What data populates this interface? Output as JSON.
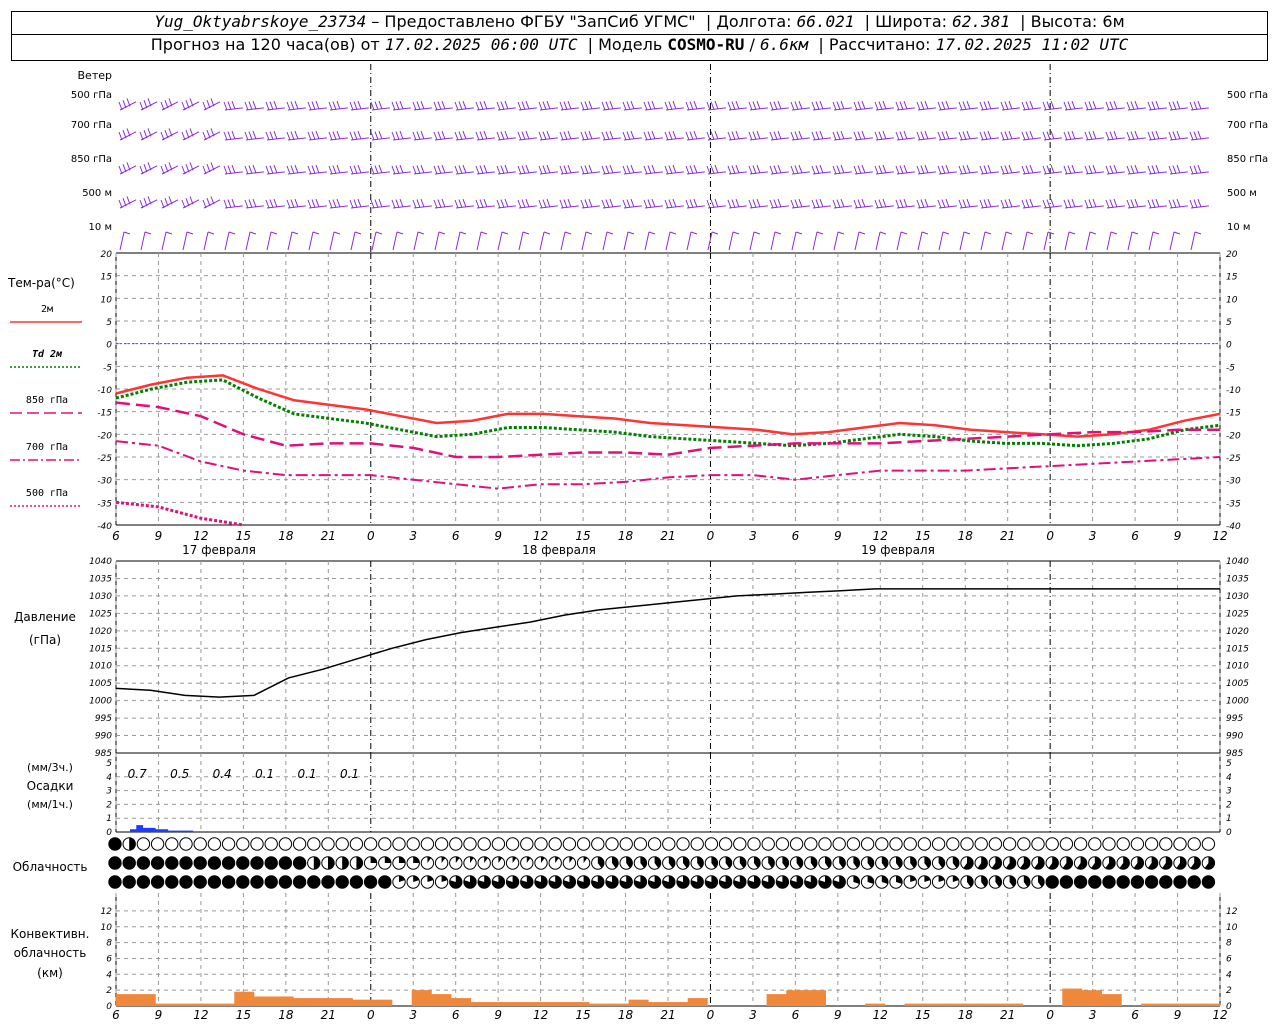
{
  "header": {
    "station": "Yug_Oktyabrskoye_23734",
    "dash": " – ",
    "provider": "Предоставлено ФГБУ \"ЗапСиб УГМС\"",
    "lon_label": "Долгота:",
    "lon": "66.021",
    "lat_label": "Широта:",
    "lat": "62.381",
    "alt_label": "Высота:",
    "alt": "6м",
    "forecast_prefix": "Прогноз на 120 часа(ов) от",
    "forecast_time": "17.02.2025 06:00 UTC",
    "model_label": "Модель",
    "model": "COSMO-RU",
    "model_res": "6.6км",
    "calc_label": "Рассчитано:",
    "calc_time": "17.02.2025 11:02 UTC"
  },
  "wind": {
    "title": "Ветер",
    "levels": [
      "500 гПа",
      "700 гПа",
      "850 гПа",
      "500 м",
      "10 м"
    ]
  },
  "temperature": {
    "title": "Тем-ра(°С)",
    "legend": [
      {
        "label": "2м",
        "color": "#ff3333",
        "style": "solid"
      },
      {
        "label": "Td 2м",
        "color": "#008000",
        "style": "dotted"
      },
      {
        "label": "850 гПа",
        "color": "#e0107a",
        "style": "longdash"
      },
      {
        "label": "700 гПа",
        "color": "#e0107a",
        "style": "dashdot"
      },
      {
        "label": "500 гПа",
        "color": "#e0107a",
        "style": "dotted"
      }
    ]
  },
  "time_axis": {
    "hour_ticks": [
      "6",
      "9",
      "12",
      "15",
      "18",
      "21",
      "0",
      "3",
      "6",
      "9",
      "12",
      "15",
      "18",
      "21",
      "0",
      "3",
      "6",
      "9",
      "12",
      "15",
      "18",
      "21",
      "0",
      "3",
      "6",
      "9",
      "12"
    ],
    "dates": [
      "17 февраля",
      "18 февраля",
      "19 февраля"
    ]
  },
  "pressure": {
    "title": "Давление",
    "unit": "(гПа)"
  },
  "precip": {
    "unit3": "(мм/3ч.)",
    "title": "Осадки",
    "unit1": "(мм/1ч.)",
    "labels": [
      "0.7",
      "0.5",
      "0.4",
      "0.1",
      "0.1",
      "0.1"
    ]
  },
  "clouds": {
    "title": "Облачность"
  },
  "convective": {
    "title1": "Конвективн.",
    "title2": "облачность",
    "unit": "(км)"
  },
  "colors": {
    "wind": "#8a2be2",
    "pressure": "#000000",
    "precip": "#1e3cff",
    "convective": "#f0883c",
    "zero_line": "#3050ff"
  },
  "chart_data": [
    {
      "type": "line",
      "title": "Тем-ра(°С)",
      "x_hours_from_start": [
        0,
        3,
        6,
        9,
        12,
        15,
        18,
        21,
        24,
        27,
        30,
        33,
        36,
        39,
        42,
        45,
        48,
        51,
        54,
        57,
        60,
        63,
        66,
        69,
        72,
        75,
        78
      ],
      "x_tick_labels": [
        "6",
        "9",
        "12",
        "15",
        "18",
        "21",
        "0",
        "3",
        "6",
        "9",
        "12",
        "15",
        "18",
        "21",
        "0",
        "3",
        "6",
        "9",
        "12",
        "15",
        "18",
        "21",
        "0",
        "3",
        "6",
        "9",
        "12"
      ],
      "ylim": [
        -40,
        20
      ],
      "y_ticks": [
        -40,
        -35,
        -30,
        -25,
        -20,
        -15,
        -10,
        -5,
        0,
        5,
        10,
        15,
        20
      ],
      "series": [
        {
          "name": "2м",
          "values": [
            -11,
            -9,
            -7.5,
            -7,
            -10,
            -12.5,
            -13.5,
            -14.5,
            -16,
            -17.5,
            -17,
            -15.5,
            -15.5,
            -16,
            -16.5,
            -17.5,
            -18,
            -18.5,
            -19,
            -20,
            -19.5,
            -18.5,
            -17.5,
            -18,
            -19,
            -19.5,
            -20,
            -20.5,
            -20,
            -19,
            -17,
            -15.5
          ]
        },
        {
          "name": "Td 2м",
          "values": [
            -12,
            -10,
            -8.5,
            -8,
            -12,
            -15.5,
            -16.5,
            -17.5,
            -19,
            -20.5,
            -20,
            -18.5,
            -18.5,
            -19,
            -19.5,
            -20.5,
            -21,
            -21.5,
            -22,
            -22.5,
            -22,
            -21,
            -20,
            -20.5,
            -21.5,
            -22,
            -22,
            -22.5,
            -22,
            -21,
            -19,
            -18
          ]
        },
        {
          "name": "850 гПа",
          "values": [
            -13,
            -14,
            -16,
            -20,
            -22.5,
            -22,
            -22,
            -23,
            -25,
            -25,
            -24.5,
            -24,
            -24,
            -24.5,
            -23,
            -22.5,
            -22,
            -22,
            -22,
            -21.5,
            -21,
            -20.5,
            -20,
            -19.5,
            -19.5,
            -19,
            -19
          ]
        },
        {
          "name": "700 гПа",
          "values": [
            -21.5,
            -22.5,
            -26,
            -28,
            -29,
            -29,
            -29,
            -30,
            -31,
            -32,
            -31,
            -31,
            -30.5,
            -29.5,
            -29,
            -29,
            -30,
            -29,
            -28,
            -28,
            -28,
            -27.5,
            -27,
            -26.5,
            -26,
            -25.5,
            -25
          ]
        },
        {
          "name": "500 гПа",
          "values": [
            -35,
            -36,
            -38.5,
            -40
          ]
        }
      ]
    },
    {
      "type": "line",
      "title": "Давление",
      "ylim": [
        985,
        1040
      ],
      "y_ticks": [
        985,
        990,
        995,
        1000,
        1005,
        1010,
        1015,
        1020,
        1025,
        1030,
        1035,
        1040
      ],
      "series": [
        {
          "name": "Давление",
          "values": [
            1003.5,
            1003,
            1001.5,
            1001,
            1001.5,
            1006.5,
            1009,
            1012,
            1015,
            1017.5,
            1019.5,
            1021,
            1022.5,
            1024.5,
            1026,
            1027,
            1028,
            1029,
            1030,
            1030.5,
            1031,
            1031.5,
            1032,
            1032,
            1032,
            1032,
            1032,
            1032,
            1032,
            1032,
            1032,
            1032,
            1032
          ]
        }
      ]
    },
    {
      "type": "bar",
      "title": "Осадки",
      "ylim": [
        0,
        5
      ],
      "values_mm_per_1h": [
        0.2,
        0.5,
        0.3,
        0.3,
        0.2,
        0.2,
        0.1,
        0.1,
        0.1,
        0.1,
        0.05,
        0.05,
        0,
        0,
        0,
        0,
        0,
        0,
        0,
        0,
        0,
        0.05,
        0,
        0,
        0,
        0,
        0,
        0.05,
        0,
        0,
        0,
        0,
        0,
        0,
        0,
        0,
        0,
        0,
        0,
        0,
        0,
        0,
        0,
        0,
        0,
        0,
        0,
        0,
        0,
        0,
        0,
        0,
        0.05,
        0,
        0,
        0,
        0,
        0,
        0,
        0,
        0,
        0,
        0,
        0,
        0,
        0,
        0,
        0,
        0,
        0,
        0,
        0,
        0,
        0,
        0,
        0,
        0,
        0,
        0,
        0,
        0,
        0,
        0,
        0,
        0,
        0,
        0,
        0,
        0,
        0,
        0,
        0,
        0,
        0,
        0,
        0,
        0,
        0,
        0,
        0,
        0,
        0,
        0,
        0,
        0,
        0,
        0,
        0.05,
        0,
        0,
        0,
        0,
        0,
        0,
        0,
        0,
        0,
        0
      ]
    },
    {
      "type": "bar",
      "title": "Конвективн. облачность",
      "ylim": [
        0,
        13
      ],
      "y_ticks": [
        0,
        2,
        4,
        6,
        8,
        10,
        12
      ],
      "values_km": [
        1.5,
        1.5,
        0.3,
        0.3,
        0.3,
        0.3,
        1.8,
        1.2,
        1.2,
        1,
        1,
        1,
        0.8,
        0.8,
        0,
        2,
        1.5,
        1,
        0.5,
        0.5,
        0.5,
        0.5,
        0.5,
        0.5,
        0.3,
        0.3,
        0.8,
        0.5,
        0.5,
        1,
        0,
        0,
        0,
        1.5,
        2,
        2,
        0,
        0,
        0.3,
        0,
        0.3,
        0.3,
        0.3,
        0.3,
        0.3,
        0.3,
        0,
        0,
        2.2,
        2,
        1.5,
        0,
        0.3,
        0.3,
        0.3,
        0.3
      ]
    }
  ]
}
